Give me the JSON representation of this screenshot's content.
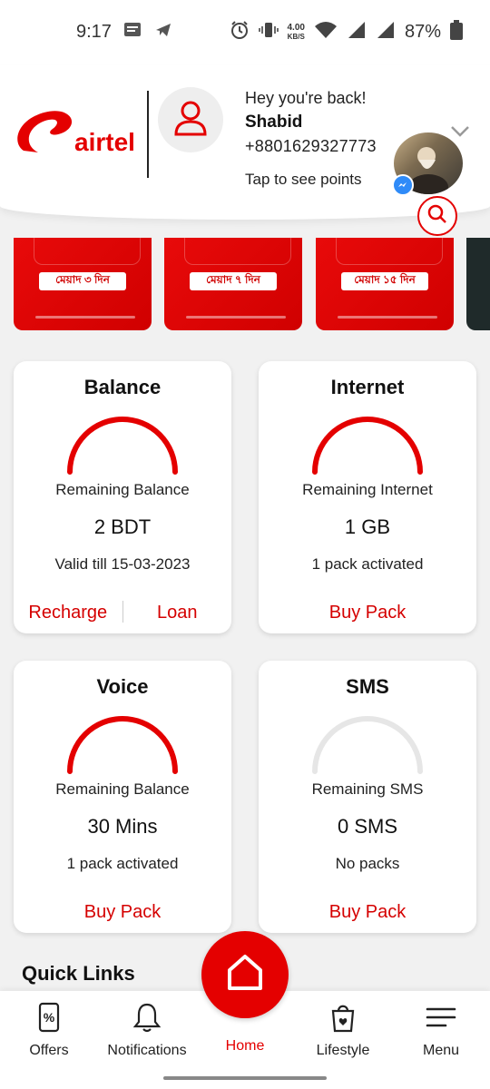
{
  "status_bar": {
    "time": "9:17",
    "speed_value": "4.00",
    "speed_unit": "KB/S",
    "battery": "87%"
  },
  "header": {
    "brand": "airtel",
    "greeting": "Hey you're back!",
    "name": "Shabid",
    "phone": "+8801629327773",
    "points_link": "Tap to see points"
  },
  "banners": [
    {
      "validity": "মেয়াদ ৩ দিন"
    },
    {
      "validity": "মেয়াদ ৭ দিন"
    },
    {
      "validity": "মেয়াদ ১৫ দিন"
    }
  ],
  "cards": {
    "balance": {
      "title": "Balance",
      "subtitle": "Remaining Balance",
      "value": "2 BDT",
      "note": "Valid till 15-03-2023",
      "action_1": "Recharge",
      "action_2": "Loan"
    },
    "internet": {
      "title": "Internet",
      "subtitle": "Remaining Internet",
      "value": "1 GB",
      "note": "1 pack activated",
      "action": "Buy Pack"
    },
    "voice": {
      "title": "Voice",
      "subtitle": "Remaining Balance",
      "value": "30 Mins",
      "note": "1 pack activated",
      "action": "Buy Pack"
    },
    "sms": {
      "title": "SMS",
      "subtitle": "Remaining SMS",
      "value": "0 SMS",
      "note": "No packs",
      "action": "Buy Pack"
    }
  },
  "quick_links_title": "Quick Links",
  "nav": {
    "offers": "Offers",
    "notifications": "Notifications",
    "home": "Home",
    "lifestyle": "Lifestyle",
    "menu": "Menu"
  },
  "colors": {
    "brand": "#e40000",
    "gauge_empty": "#e6e6e6"
  }
}
